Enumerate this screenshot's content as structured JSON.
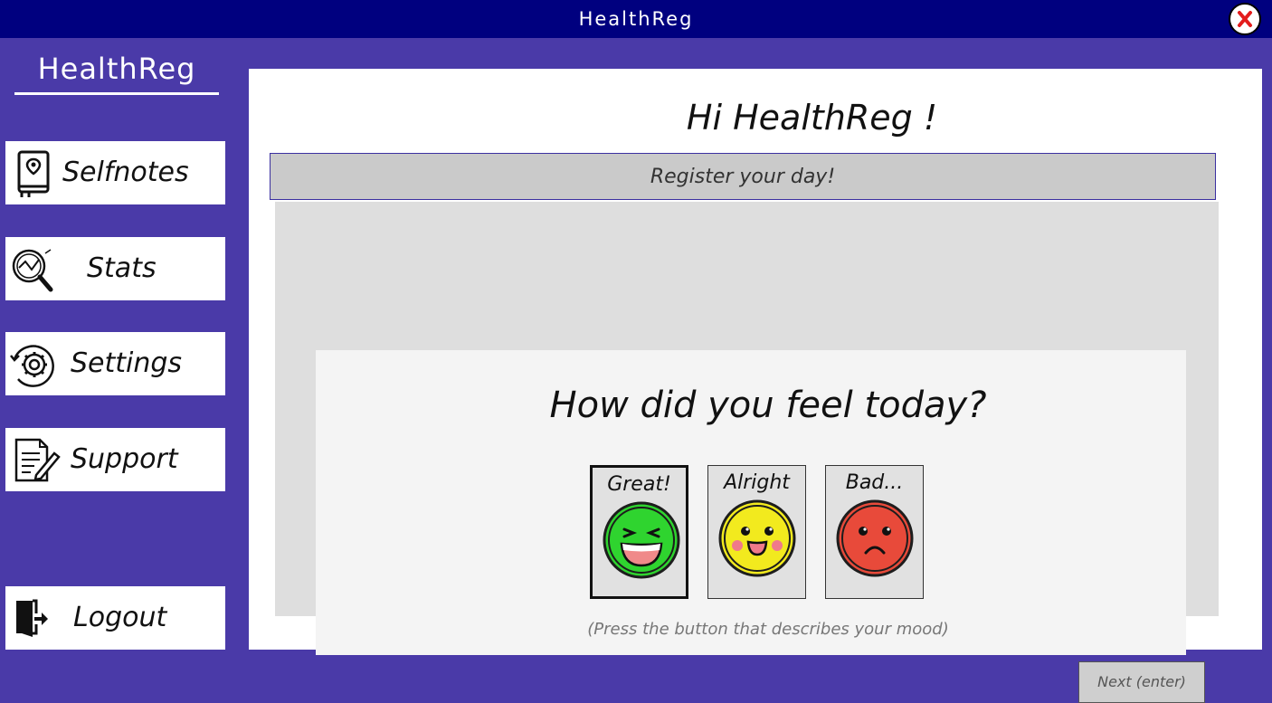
{
  "window": {
    "title": "HealthReg",
    "close_icon": "close-x-icon"
  },
  "sidebar": {
    "brand": "HealthReg",
    "items": [
      {
        "label": "Selfnotes",
        "icon": "notebook-icon"
      },
      {
        "label": "Stats",
        "icon": "magnifier-chart-icon"
      },
      {
        "label": "Settings",
        "icon": "gear-icon"
      },
      {
        "label": "Support",
        "icon": "document-edit-icon"
      }
    ],
    "logout": {
      "label": "Logout",
      "icon": "exit-door-icon"
    }
  },
  "main": {
    "greeting": "Hi HealthReg !",
    "panel_header": "Register your day!",
    "question": "How did you feel today?",
    "moods": [
      {
        "label": "Great!",
        "color": "#2fd42f",
        "selected": true
      },
      {
        "label": "Alright",
        "color": "#f2ea1e",
        "selected": false
      },
      {
        "label": "Bad...",
        "color": "#e84a3a",
        "selected": false
      }
    ],
    "hint": "(Press the button that describes your mood)",
    "next_button": "Next (enter)"
  },
  "colors": {
    "titlebar": "#00007f",
    "sidebar": "#4a3aa8",
    "panel": "#dedede",
    "header": "#cacaca"
  }
}
